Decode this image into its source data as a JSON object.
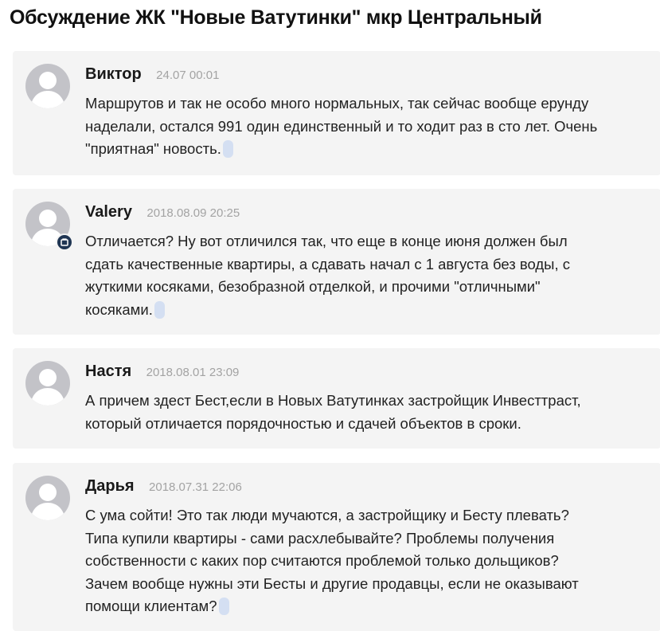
{
  "page": {
    "title": "Обсуждение ЖК \"Новые Ватутинки\" мкр Центральный"
  },
  "comments": [
    {
      "author": "Виктор",
      "date": "24.07 00:01",
      "lines": [
        "Маршрутов и так не особо много нормальных, так сейчас вообще ерунду",
        "наделали, остался 991 один единственный и то ходит раз в сто лет. Очень",
        "\"приятная\" новость."
      ]
    },
    {
      "author": "Valery",
      "date": "2018.08.09 20:25",
      "lines": [
        "Отличается? Ну вот отличился так, что еще в конце июня должен был",
        "сдать качественные квартиры, а сдавать начал с 1 августа без воды, с",
        "жуткими косяками, безобразной отделкой, и прочими \"отличными\"",
        "косяками."
      ]
    },
    {
      "author": "Настя",
      "date": "2018.08.01 23:09",
      "lines": [
        "А причем здест Бест,если в Новых Ватутинках застройщик Инвесттраст,",
        "который отличается порядочностью и сдачей объектов в сроки."
      ]
    },
    {
      "author": "Дарья",
      "date": "2018.07.31 22:06",
      "lines": [
        "С ума сойти! Это так люди мучаются, а застройщику и Бесту плевать?",
        "Типа купили квартиры - сами расхлебывайте? Проблемы получения",
        "собственности с каких пор считаются проблемой только дольщиков?",
        "Зачем вообще нужны эти Бесты и другие продавцы, если не оказывают",
        "помощи клиентам?"
      ]
    }
  ],
  "icons": {
    "avatar": "user-silhouette-icon",
    "badge": "verified-badge-icon"
  },
  "colors": {
    "card_background": "#f4f4f4",
    "avatar": "#c3c3c8",
    "date_text": "#a3a3a3",
    "badge": "#1f3553",
    "marker": "#d4dff2"
  }
}
